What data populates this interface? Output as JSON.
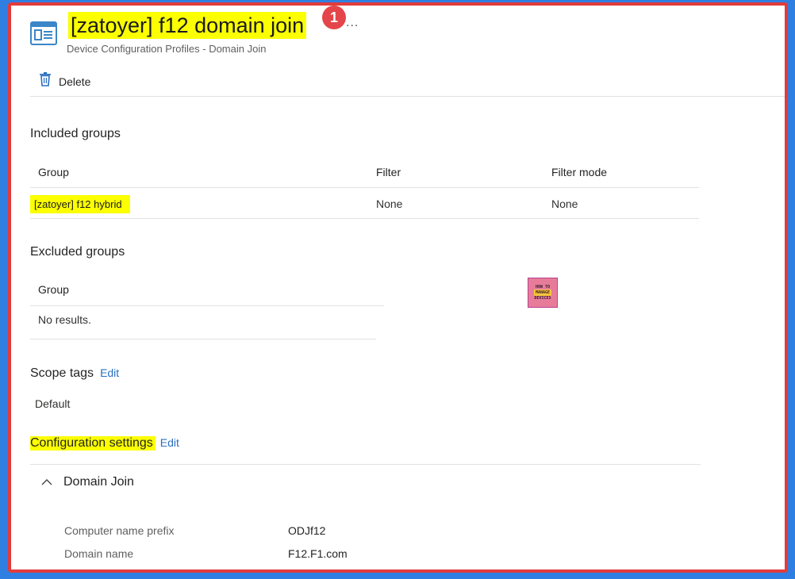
{
  "header": {
    "title": "[zatoyer] f12 domain join",
    "badge": "1",
    "more_actions": "...",
    "subtitle": "Device Configuration Profiles - Domain Join",
    "icon": "config-profile-icon"
  },
  "toolbar": {
    "delete_label": "Delete",
    "delete_icon": "trash-icon"
  },
  "included_groups": {
    "title": "Included groups",
    "columns": [
      "Group",
      "Filter",
      "Filter mode"
    ],
    "rows": [
      {
        "group": "[zatoyer] f12 hybrid",
        "filter": "None",
        "filter_mode": "None"
      }
    ]
  },
  "excluded_groups": {
    "title": "Excluded groups",
    "columns": [
      "Group"
    ],
    "empty_text": "No results."
  },
  "watermark": {
    "text": "HOW TO MANAGE DEVICES"
  },
  "scope_tags": {
    "title": "Scope tags",
    "edit_label": "Edit",
    "value": "Default"
  },
  "configuration_settings": {
    "title": "Configuration settings",
    "edit_label": "Edit",
    "section_label": "Domain Join",
    "settings": [
      {
        "key": "Computer name prefix",
        "value": "ODJf12"
      },
      {
        "key": "Domain name",
        "value": "F12.F1.com"
      }
    ]
  },
  "colors": {
    "highlight": "#fbff00",
    "link": "#2a6fbf",
    "frame_border": "#e23b3b",
    "badge": "#e4454a",
    "background": "#2f7fe2"
  }
}
